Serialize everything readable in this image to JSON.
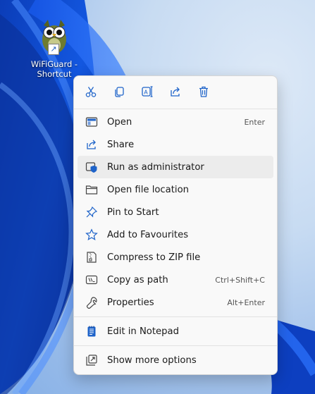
{
  "desktop": {
    "icon_label_line1": "WiFiGuard -",
    "icon_label_line2": "Shortcut"
  },
  "context_menu": {
    "toolbar": [
      {
        "name": "cut-button",
        "icon": "scissors-icon"
      },
      {
        "name": "copy-button",
        "icon": "copy-icon"
      },
      {
        "name": "rename-button",
        "icon": "rename-icon"
      },
      {
        "name": "share-button",
        "icon": "share-icon"
      },
      {
        "name": "delete-button",
        "icon": "trash-icon"
      }
    ],
    "items": [
      {
        "label": "Open",
        "shortcut": "Enter",
        "icon": "open-icon"
      },
      {
        "label": "Share",
        "shortcut": "",
        "icon": "share-icon"
      },
      {
        "label": "Run as administrator",
        "shortcut": "",
        "icon": "shield-icon"
      },
      {
        "label": "Open file location",
        "shortcut": "",
        "icon": "folder-icon"
      },
      {
        "label": "Pin to Start",
        "shortcut": "",
        "icon": "pin-icon"
      },
      {
        "label": "Add to Favourites",
        "shortcut": "",
        "icon": "star-icon"
      },
      {
        "label": "Compress to ZIP file",
        "shortcut": "",
        "icon": "zip-icon"
      },
      {
        "label": "Copy as path",
        "shortcut": "Ctrl+Shift+C",
        "icon": "path-icon"
      },
      {
        "label": "Properties",
        "shortcut": "Alt+Enter",
        "icon": "wrench-icon"
      },
      {
        "label": "Edit in Notepad",
        "shortcut": "",
        "icon": "notepad-icon"
      },
      {
        "label": "Show more options",
        "shortcut": "",
        "icon": "more-options-icon"
      }
    ]
  },
  "colors": {
    "accent": "#1e63c9",
    "menu_bg": "#f9f9f9",
    "hover_bg": "#ececec"
  }
}
